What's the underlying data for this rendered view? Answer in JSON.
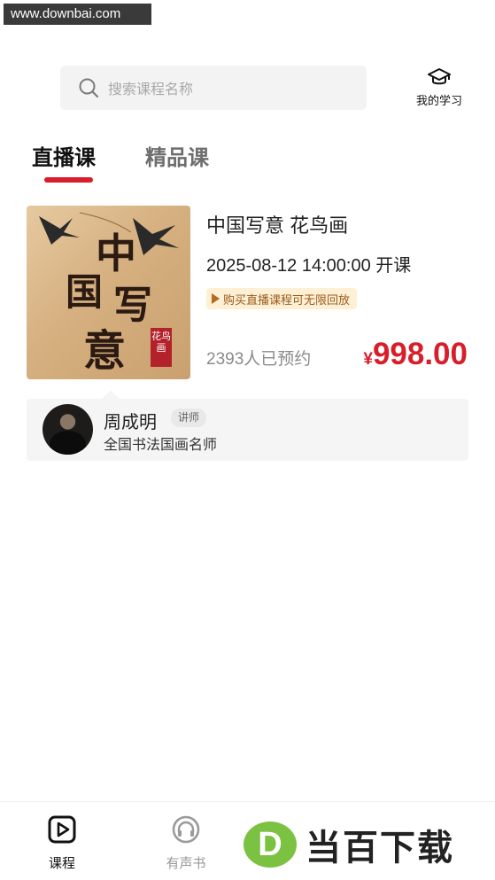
{
  "watermark": {
    "text": "www.downbai.com"
  },
  "search": {
    "placeholder": "搜索课程名称",
    "icon": "search-icon"
  },
  "my_study": {
    "label": "我的学习",
    "icon": "graduation-cap-icon"
  },
  "tabs": [
    {
      "label": "直播课",
      "active": true
    },
    {
      "label": "精品课",
      "active": false
    }
  ],
  "accent_color": "#d81e2a",
  "course": {
    "cover": {
      "title_chars": [
        "中",
        "国",
        "写",
        "意"
      ],
      "seal_text": "花鸟画"
    },
    "title": "中国写意 花鸟画",
    "start_time": "2025-08-12 14:00:00 开课",
    "replay_badge": "购买直播课程可无限回放",
    "reservations": "2393人已预约",
    "price_symbol": "¥",
    "price": "998.00"
  },
  "teacher": {
    "name": "周成明",
    "tag": "讲师",
    "description": "全国书法国画名师"
  },
  "bottom_nav": [
    {
      "label": "课程",
      "icon": "play-square-icon",
      "active": true
    },
    {
      "label": "有声书",
      "icon": "headphones-icon",
      "active": false
    }
  ],
  "brand_logo": {
    "letter": "D",
    "text": "当百下载"
  }
}
